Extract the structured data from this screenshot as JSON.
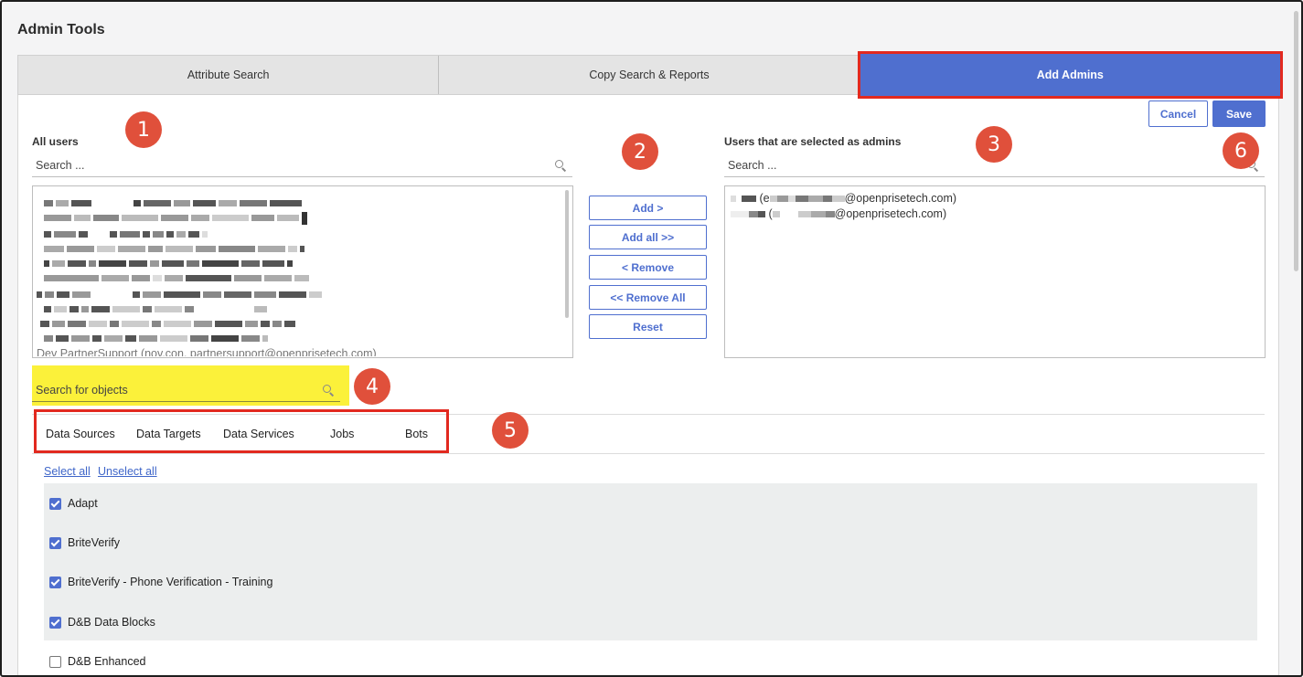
{
  "page": {
    "title": "Admin Tools"
  },
  "tabs": [
    {
      "label": "Attribute Search",
      "active": false
    },
    {
      "label": "Copy Search & Reports",
      "active": false
    },
    {
      "label": "Add Admins",
      "active": true
    }
  ],
  "actions": {
    "cancel": "Cancel",
    "save": "Save"
  },
  "all_users": {
    "label": "All users",
    "search_placeholder": "Search ...",
    "partial_last_row": "Dev PartnerSupport (nov.con. partnersupport@openprisetech.com)"
  },
  "transfer_buttons": [
    "Add >",
    "Add all >>",
    "< Remove",
    "<< Remove All",
    "Reset"
  ],
  "selected_admins": {
    "label": "Users that are selected as admins",
    "search_placeholder": "Search ...",
    "users": [
      {
        "name_suffix": "(e",
        "email_suffix": "@openprisetech.com)"
      },
      {
        "name_suffix": "(",
        "email_suffix": "@openprisetech.com)"
      }
    ]
  },
  "object_search": {
    "placeholder": "Search for objects"
  },
  "object_tabs": [
    "Data Sources",
    "Data Targets",
    "Data Services",
    "Jobs",
    "Bots"
  ],
  "links": {
    "select_all": "Select all",
    "unselect_all": "Unselect all"
  },
  "objects": [
    {
      "label": "Adapt",
      "checked": true
    },
    {
      "label": "BriteVerify",
      "checked": true
    },
    {
      "label": "BriteVerify - Phone Verification - Training",
      "checked": true
    },
    {
      "label": "D&B Data Blocks",
      "checked": true
    },
    {
      "label": "D&B Enhanced",
      "checked": false
    }
  ],
  "badges": [
    "1",
    "2",
    "3",
    "4",
    "5",
    "6"
  ],
  "colors": {
    "accent": "#4f6fcf",
    "highlight_red": "#e2291f",
    "badge": "#e0503b",
    "highlight_yellow": "#fbf13a"
  }
}
